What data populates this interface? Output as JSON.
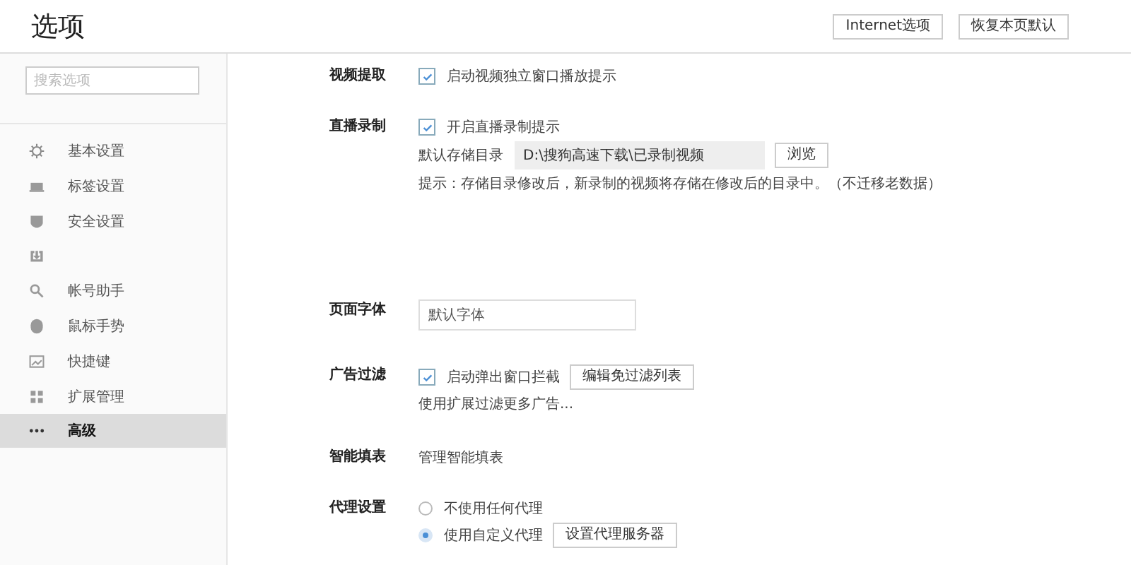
{
  "window": {
    "title": "选项"
  },
  "header_buttons": [
    "Internet选项",
    "恢复本页默认"
  ],
  "sidebar": {
    "search_placeholder": "搜索选项",
    "items": [
      {
        "label": "基本设置",
        "selected": false
      },
      {
        "label": "标签设置",
        "selected": false
      },
      {
        "label": "安全设置",
        "selected": false
      },
      {
        "selected": false
      },
      {
        "label": "帐号助手",
        "selected": false
      },
      {
        "label": "鼠标手势",
        "selected": false
      },
      {
        "label": "快捷键",
        "selected": false
      },
      {
        "label": "扩展管理",
        "selected": false
      },
      {
        "label": "高级",
        "selected": true
      }
    ]
  },
  "sections": [
    {
      "label": "视频提取",
      "items": [
        {
          "kind": "checkbox",
          "label": "启动视频独立窗口播放提示",
          "checked": true
        }
      ]
    },
    {
      "label": "直播录制",
      "items": [
        {
          "kind": "checkbox",
          "label": "开启直播录制提示",
          "checked": true
        },
        {
          "kind": "path",
          "label": "默认存储目录",
          "value": "D:\\搜狗高速下载\\已录制视频",
          "button": "浏览"
        },
        {
          "kind": "hint",
          "text": "提示：存储目录修改后，新录制的视频将存储在修改后的目录中。（不迁移老数据）"
        }
      ]
    },
    {
      "label": "页面字体",
      "items": [
        {
          "kind": "select",
          "value": "默认字体"
        }
      ]
    },
    {
      "label": "广告过滤",
      "items": [
        {
          "kind": "checkbox",
          "label": "启动弹出窗口拦截",
          "checked": true,
          "button": "编辑免过滤列表"
        },
        {
          "kind": "hint",
          "text": "使用扩展过滤更多广告..."
        }
      ]
    },
    {
      "label": "智能填表",
      "items": [
        {
          "kind": "hint",
          "text": "管理智能填表"
        }
      ]
    },
    {
      "label": "代理设置",
      "items": [
        {
          "kind": "radio",
          "label": "不使用任何代理",
          "selected": false
        },
        {
          "kind": "radio",
          "label": "使用自定义代理",
          "selected": true,
          "button": "设置代理服务器"
        }
      ]
    }
  ]
}
